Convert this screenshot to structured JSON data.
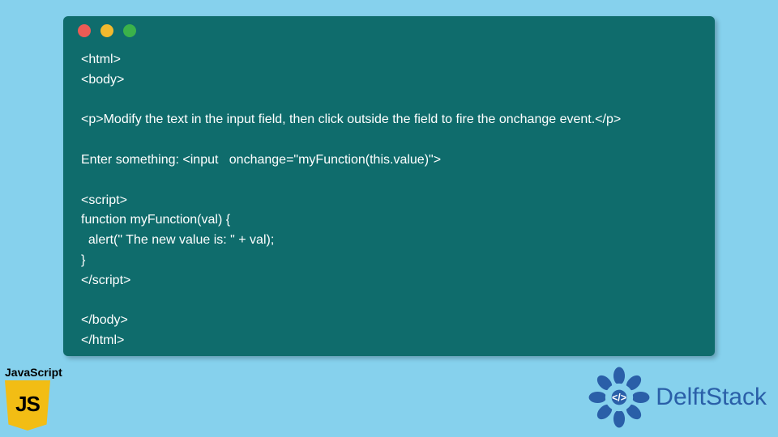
{
  "window": {
    "dots": [
      "red",
      "yellow",
      "green"
    ]
  },
  "code": {
    "lines": [
      "<html>",
      "<body>",
      "",
      "<p>Modify the text in the input field, then click outside the field to fire the onchange event.</p>",
      "",
      "Enter something: <input   onchange=\"myFunction(this.value)\">",
      "",
      "<script>",
      "function myFunction(val) {",
      "  alert(\" The new value is: \" + val);",
      "}",
      "</script>",
      "",
      "</body>",
      "</html>"
    ]
  },
  "badges": {
    "js_label": "JavaScript",
    "js_shield_text": "JS",
    "brand": "DelftStack"
  },
  "colors": {
    "bg": "#86d1ed",
    "panel": "#0f6c6c",
    "brand_blue": "#2a5fa8",
    "js_yellow": "#f2bd14"
  }
}
